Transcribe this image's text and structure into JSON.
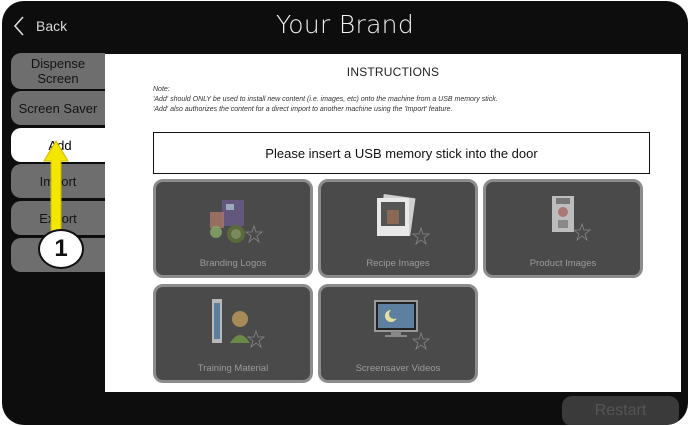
{
  "header": {
    "back_label": "Back",
    "title": "Your Brand"
  },
  "sidebar": {
    "tabs": [
      {
        "label_line1": "Dispense",
        "label_line2": "Screen",
        "active": false
      },
      {
        "label": "Screen Saver",
        "active": false
      },
      {
        "label": "Add",
        "active": true
      },
      {
        "label": "Import",
        "active": false
      },
      {
        "label": "Export",
        "active": false
      },
      {
        "label": "",
        "active": false
      }
    ]
  },
  "panel": {
    "heading": "INSTRUCTIONS",
    "note_title": "Note:",
    "note_line1": "'Add' should ONLY be used to install new content (i.e. images, etc) onto the machine from a USB memory stick.",
    "note_line2": "'Add' also authorizes the content for a direct import to another machine using the 'Import' feature.",
    "usb_prompt": "Please insert a USB memory stick into the door",
    "tiles": [
      {
        "label": "Branding Logos",
        "icon": "branding-logos-icon"
      },
      {
        "label": "Recipe Images",
        "icon": "recipe-images-icon"
      },
      {
        "label": "Product Images",
        "icon": "product-images-icon"
      },
      {
        "label": "Training Material",
        "icon": "training-material-icon"
      },
      {
        "label": "Screensaver Videos",
        "icon": "screensaver-videos-icon"
      }
    ]
  },
  "footer": {
    "restart_label": "Restart"
  },
  "annotation": {
    "callout_number": "1"
  },
  "colors": {
    "device_bg": "#0d0d0d",
    "tab_inactive": "#6e6e6e",
    "tile_bg": "#4a4a4a",
    "callout_arrow": "#f5e600"
  }
}
